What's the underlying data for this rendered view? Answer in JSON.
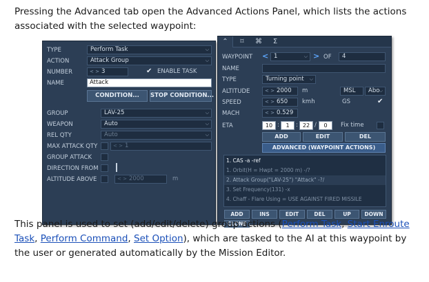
{
  "intro_text": "Pressing the Advanced tab open the Advanced Actions Panel, which lists the actions associated with the selected waypoint:",
  "outro": {
    "pre": "This panel is used to set (add/edit/delete) group actions (",
    "link1": "Perform Task",
    "sep1": ", ",
    "link2": "Start Enroute Task",
    "sep2": ", ",
    "link3": "Perform Command",
    "sep3": ", ",
    "link4": "Set Option",
    "post": "), which are tasked to the AI at this waypoint by the user or generated automatically by the Mission Editor."
  },
  "left_panel": {
    "type_label": "TYPE",
    "type_value": "Perform Task",
    "action_label": "ACTION",
    "action_value": "Attack Group",
    "number_label": "NUMBER",
    "number_value": "3",
    "enable_task_label": "ENABLE TASK",
    "name_label": "NAME",
    "name_value": "Attack",
    "condition_button": "CONDITION...",
    "stop_condition_button": "STOP CONDITION...",
    "group_label": "GROUP",
    "group_value": "LAV-25",
    "weapon_label": "WEAPON",
    "weapon_value": "Auto",
    "rel_qty_label": "REL QTY",
    "rel_qty_value": "Auto",
    "max_attack_qty_label": "MAX ATTACK QTY",
    "max_attack_qty_value": "1",
    "group_attack_label": "GROUP ATTACK",
    "direction_from_label": "DIRECTION FROM",
    "altitude_above_label": "ALTITUDE ABOVE",
    "altitude_above_value": "2000",
    "altitude_unit": "m"
  },
  "right_panel": {
    "tabs": [
      "⌃",
      "⌑",
      "⌘",
      "Σ"
    ],
    "waypoint_label": "WAYPOINT",
    "waypoint_value": "1",
    "of_label": "OF",
    "of_value": "4",
    "name_label": "NAME",
    "type_label": "TYPE",
    "type_value": "Turning point",
    "altitude_label": "ALTITUDE",
    "altitude_value": "2000",
    "altitude_unit": "m",
    "alt_ref_value": "MSL",
    "alt_ref2_value": "Abo",
    "speed_label": "SPEED",
    "speed_value": "650",
    "speed_unit": "kmh",
    "gs_label": "GS",
    "mach_label": "MACH",
    "mach_value": "0.529",
    "eta_label": "ETA",
    "eta_h": "10",
    "eta_m": "1",
    "eta_s": "22",
    "eta_d": "0",
    "fix_time_label": "Fix time",
    "add_button": "ADD",
    "edit_button": "EDIT",
    "del_button": "DEL",
    "advanced_button": "ADVANCED (WAYPOINT ACTIONS)",
    "actions": [
      "1. CAS -a -ref",
      "1. Orbit(H = Hwpt = 2000 m) -/?",
      "2. Attack Group(\"LAV-25\") \"Attack\" -?/",
      "3. Set Frequency(131) -x",
      "4. Chaff - Flare Using = USE AGAINST FIRED MISSILE"
    ],
    "action_buttons": {
      "add": "ADD",
      "ins": "INS",
      "edit": "EDIT",
      "del": "DEL",
      "up": "UP",
      "down": "DOWN",
      "clone": "CLONE"
    }
  },
  "colors": {
    "panel_bg": "#2c3e55",
    "field_bg": "#1e2d40",
    "button_bg": "#3c5572",
    "highlight_blue": "#5ea8ff",
    "link_blue": "#1a4fb8"
  }
}
